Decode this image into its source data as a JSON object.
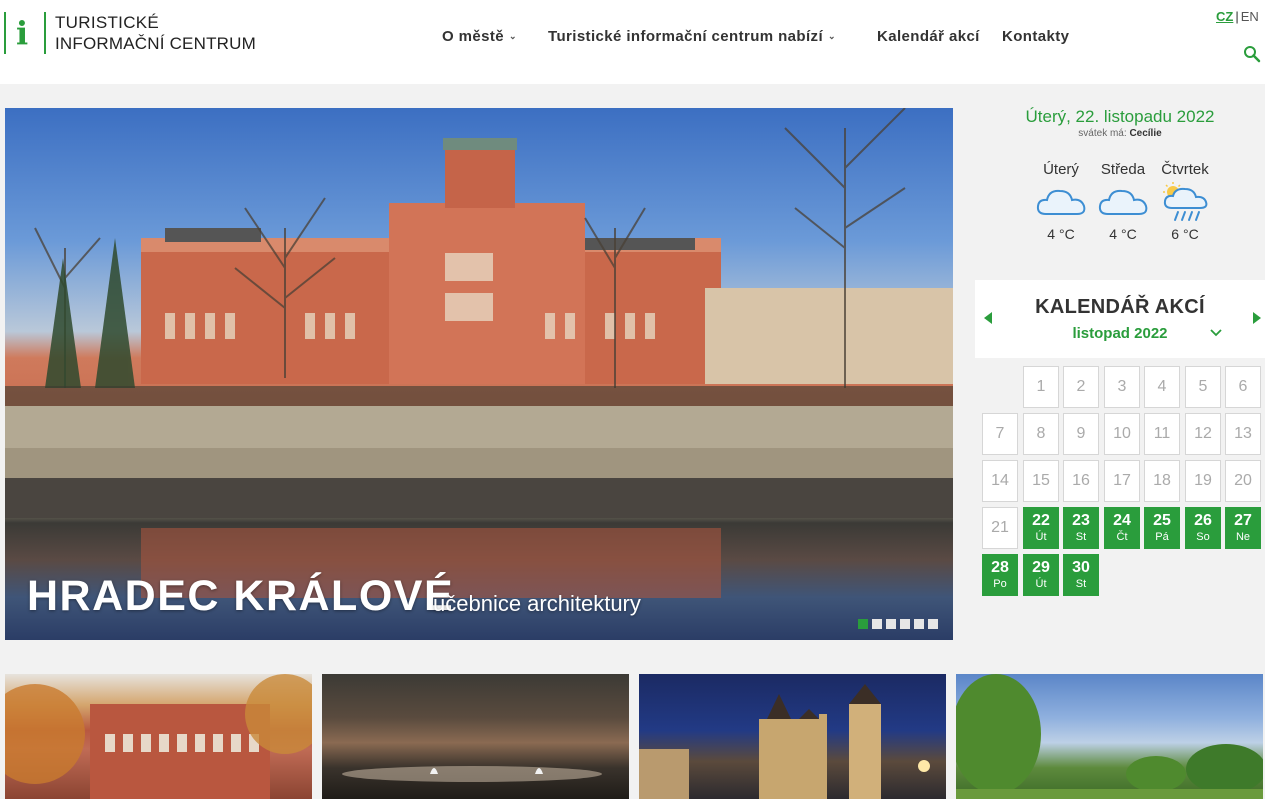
{
  "header": {
    "logo_line1": "TURISTICKÉ",
    "logo_line2": "INFORMAČNÍ CENTRUM",
    "logo_icon": "info-i-icon",
    "nav": [
      {
        "label": "O městě",
        "has_dropdown": true
      },
      {
        "label": "Turistické informační centrum nabízí",
        "has_dropdown": true
      },
      {
        "label": "Kalendář akcí",
        "has_dropdown": false
      },
      {
        "label": "Kontakty",
        "has_dropdown": false
      }
    ],
    "lang": {
      "active": "CZ",
      "separator": "|",
      "other": "EN"
    },
    "search_icon": "search-icon"
  },
  "hero": {
    "title": "HRADEC KRÁLOVÉ",
    "subtitle": "učebnice architektury",
    "slides_count": 6,
    "active_slide": 1
  },
  "today": {
    "date": "Úterý, 22. listopadu 2022",
    "nameday_label": "svátek má:",
    "nameday_name": "Cecílie"
  },
  "weather": [
    {
      "day": "Úterý",
      "icon": "cloud-icon",
      "temp": "4 °C"
    },
    {
      "day": "Středa",
      "icon": "cloud-icon",
      "temp": "4 °C"
    },
    {
      "day": "Čtvrtek",
      "icon": "sun-rain-icon",
      "temp": "6 °C"
    }
  ],
  "calendar": {
    "title": "KALENDÁŘ AKCÍ",
    "month": "listopad 2022",
    "days": [
      {
        "n": "1"
      },
      {
        "n": "2"
      },
      {
        "n": "3"
      },
      {
        "n": "4"
      },
      {
        "n": "5"
      },
      {
        "n": "6"
      },
      {
        "n": "7"
      },
      {
        "n": "8"
      },
      {
        "n": "9"
      },
      {
        "n": "10"
      },
      {
        "n": "11"
      },
      {
        "n": "12"
      },
      {
        "n": "13"
      },
      {
        "n": "14"
      },
      {
        "n": "15"
      },
      {
        "n": "16"
      },
      {
        "n": "17"
      },
      {
        "n": "18"
      },
      {
        "n": "19"
      },
      {
        "n": "20"
      },
      {
        "n": "21"
      },
      {
        "n": "22",
        "d": "Út"
      },
      {
        "n": "23",
        "d": "St"
      },
      {
        "n": "24",
        "d": "Čt"
      },
      {
        "n": "25",
        "d": "Pá"
      },
      {
        "n": "26",
        "d": "So"
      },
      {
        "n": "27",
        "d": "Ne"
      },
      {
        "n": "28",
        "d": "Po"
      },
      {
        "n": "29",
        "d": "Út"
      },
      {
        "n": "30",
        "d": "St"
      }
    ]
  },
  "colors": {
    "accent": "#2a9d3c",
    "header_bg": "#ffffff",
    "page_bg": "#f2f2f2"
  }
}
